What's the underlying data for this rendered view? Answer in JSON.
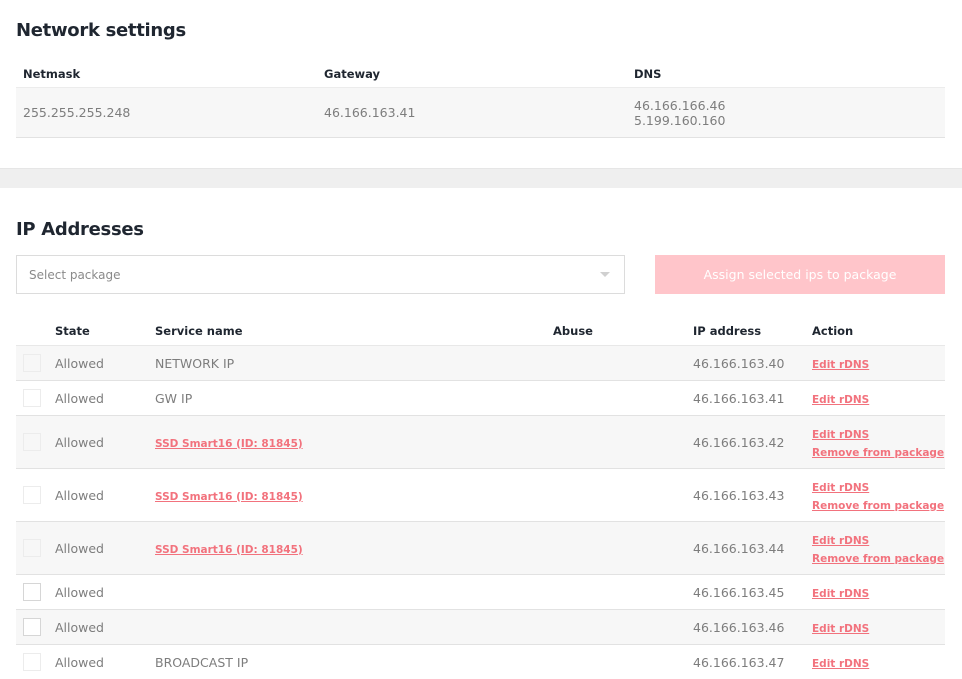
{
  "network_settings": {
    "title": "Network settings",
    "headers": {
      "netmask": "Netmask",
      "gateway": "Gateway",
      "dns": "DNS"
    },
    "values": {
      "netmask": "255.255.255.248",
      "gateway": "46.166.163.41",
      "dns": [
        "46.166.166.46",
        "5.199.160.160"
      ]
    }
  },
  "ip_addresses": {
    "title": "IP Addresses",
    "select_package": {
      "placeholder": "Select package"
    },
    "assign_button": "Assign selected ips to package",
    "headers": {
      "state": "State",
      "service": "Service name",
      "abuse": "Abuse",
      "ip": "IP address",
      "action": "Action"
    },
    "rows": [
      {
        "state": "Allowed",
        "service": "NETWORK IP",
        "service_is_link": false,
        "abuse": "",
        "ip": "46.166.163.40",
        "actions": [
          "Edit rDNS"
        ],
        "selectable": false
      },
      {
        "state": "Allowed",
        "service": "GW IP",
        "service_is_link": false,
        "abuse": "",
        "ip": "46.166.163.41",
        "actions": [
          "Edit rDNS"
        ],
        "selectable": false
      },
      {
        "state": "Allowed",
        "service": "SSD Smart16 (ID: 81845)",
        "service_is_link": true,
        "abuse": "",
        "ip": "46.166.163.42",
        "actions": [
          "Edit rDNS",
          "Remove from package"
        ],
        "selectable": false
      },
      {
        "state": "Allowed",
        "service": "SSD Smart16 (ID: 81845)",
        "service_is_link": true,
        "abuse": "",
        "ip": "46.166.163.43",
        "actions": [
          "Edit rDNS",
          "Remove from package"
        ],
        "selectable": false
      },
      {
        "state": "Allowed",
        "service": "SSD Smart16 (ID: 81845)",
        "service_is_link": true,
        "abuse": "",
        "ip": "46.166.163.44",
        "actions": [
          "Edit rDNS",
          "Remove from package"
        ],
        "selectable": false
      },
      {
        "state": "Allowed",
        "service": "",
        "service_is_link": false,
        "abuse": "",
        "ip": "46.166.163.45",
        "actions": [
          "Edit rDNS"
        ],
        "selectable": true
      },
      {
        "state": "Allowed",
        "service": "",
        "service_is_link": false,
        "abuse": "",
        "ip": "46.166.163.46",
        "actions": [
          "Edit rDNS"
        ],
        "selectable": true
      },
      {
        "state": "Allowed",
        "service": "BROADCAST IP",
        "service_is_link": false,
        "abuse": "",
        "ip": "46.166.163.47",
        "actions": [
          "Edit rDNS"
        ],
        "selectable": false
      }
    ]
  },
  "colors": {
    "link": "#f2727d",
    "button_disabled": "#ffc5ca",
    "heading": "#1f2630",
    "row_alt": "#f7f7f7"
  }
}
